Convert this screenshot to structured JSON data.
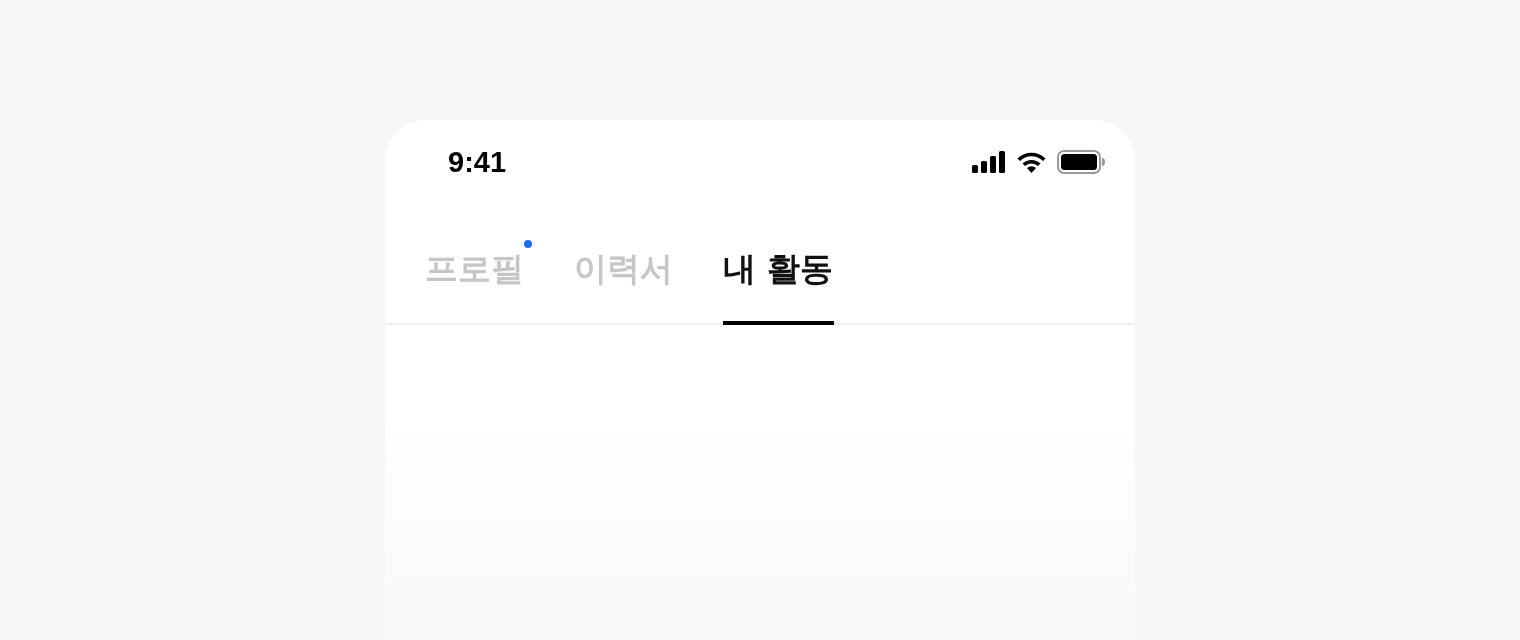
{
  "status_bar": {
    "time": "9:41"
  },
  "tabs": [
    {
      "label": "프로필",
      "selected": false,
      "has_new": true
    },
    {
      "label": "이력서",
      "selected": false,
      "has_new": false
    },
    {
      "label": "내 활동",
      "selected": true,
      "has_new": false
    }
  ]
}
